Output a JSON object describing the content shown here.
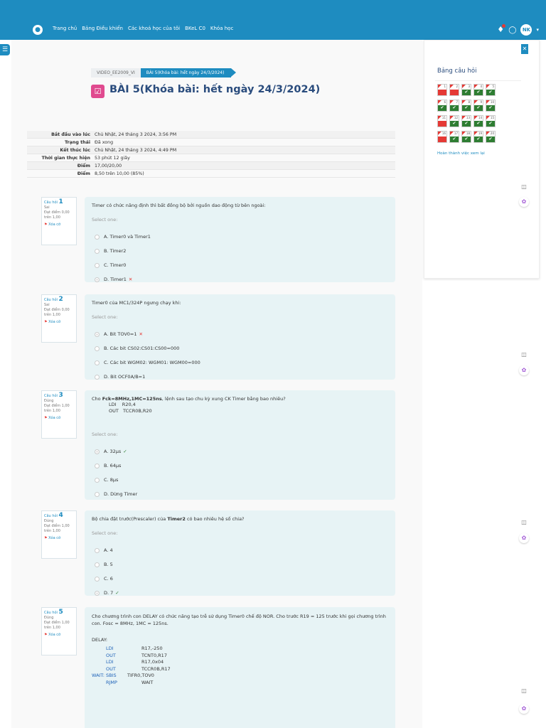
{
  "nav": {
    "items": [
      "Trang chủ",
      "Bảng Điều khiển",
      "Các khoá học của tôi",
      "BKeL C0",
      "Khóa học"
    ],
    "avatar": "NK",
    "caret": "▾"
  },
  "breadcrumbs": [
    "VIDEO_EE2009_VI",
    "BÀI 5(Khóa bài: hết ngày 24/3/2024)"
  ],
  "title": "BÀI 5(Khóa bài: hết ngày 24/3/2024)",
  "summary": [
    {
      "k": "Bắt đầu vào lúc",
      "v": "Chủ Nhật, 24 tháng 3 2024, 3:56 PM"
    },
    {
      "k": "Trạng thái",
      "v": "Đã xong"
    },
    {
      "k": "Kết thúc lúc",
      "v": "Chủ Nhật, 24 tháng 3 2024, 4:49 PM"
    },
    {
      "k": "Thời gian thực hiện",
      "v": "53 phút 12 giây"
    },
    {
      "k": "Điểm",
      "v": "17,00/20,00"
    },
    {
      "k": "Điểm",
      "v": "8,50 trên 10,00 (85%)"
    }
  ],
  "questions": [
    {
      "label": "Câu hỏi",
      "num": "1",
      "status": "Sai",
      "score": "Đạt điểm 0,00",
      "outof": "trên 1,00",
      "flag": "Xóa cờ",
      "text": "Timer có chức năng định thì bất đồng bộ bởi nguồn dao động từ bên ngoài:",
      "select": "Select one:",
      "options": [
        {
          "l": "A.",
          "t": "Timer0 và Timer1"
        },
        {
          "l": "B.",
          "t": "Timer2"
        },
        {
          "l": "C.",
          "t": "Timer0"
        },
        {
          "l": "D.",
          "t": "Timer1",
          "mark": "✕"
        }
      ]
    },
    {
      "label": "Câu hỏi",
      "num": "2",
      "status": "Sai",
      "score": "Đạt điểm 0,00",
      "outof": "trên 1,00",
      "flag": "Xóa cờ",
      "text": "Timer0 của MC1/324P ngưng chạy khi:",
      "select": "Select one:",
      "options": [
        {
          "l": "A.",
          "t": "Bit TOV0=1",
          "mark": "✕"
        },
        {
          "l": "B.",
          "t": "Các bit CS02:CS01:CS00=000"
        },
        {
          "l": "C.",
          "t": "Các bit WGM02: WGM01: WGM00=000"
        },
        {
          "l": "D.",
          "t": "Bit OCF0A/B=1"
        }
      ]
    },
    {
      "label": "Câu hỏi",
      "num": "3",
      "status": "Đúng",
      "score": "Đạt điểm 1,00",
      "outof": "trên 1,00",
      "flag": "Xóa cờ",
      "text_pre": "Cho ",
      "text_bold": "Fck=8MHz,1MC=125ns",
      "text_post": ", lệnh sau tạo chu kỳ xung CK Timer bằng bao nhiêu?",
      "code": [
        "LDI    R20,4",
        "OUT   TCCR0B,R20"
      ],
      "select": "Select one:",
      "options": [
        {
          "l": "A.",
          "t": "32μs",
          "mark": "✓"
        },
        {
          "l": "B.",
          "t": "64μs"
        },
        {
          "l": "C.",
          "t": "8μs"
        },
        {
          "l": "D.",
          "t": "Dừng Timer"
        }
      ]
    },
    {
      "label": "Câu hỏi",
      "num": "4",
      "status": "Đúng",
      "score": "Đạt điểm 1,00",
      "outof": "trên 1,00",
      "flag": "Xóa cờ",
      "text_pre": "Bộ chia đặt trước(Prescaler) của ",
      "text_bold": "Timer2",
      "text_post": " có bao nhiêu hệ số chia?",
      "select": "Select one:",
      "options": [
        {
          "l": "A.",
          "t": "4"
        },
        {
          "l": "B.",
          "t": "5"
        },
        {
          "l": "C.",
          "t": "6"
        },
        {
          "l": "D.",
          "t": "7",
          "mark": "✓"
        }
      ]
    },
    {
      "label": "Câu hỏi",
      "num": "5",
      "status": "Đúng",
      "score": "Đạt điểm 1,00",
      "outof": "trên 1,00",
      "flag": "Xóa cờ",
      "text": "Cho chương trình con DELAY có chức năng tạo trễ sử dụng Timer0 chế độ NOR. Cho trước R19 = 125 trước khi gọi chương trình con. Fosc = 8MHz, 1MC = 125ns.",
      "code_label": "DELAY:",
      "code": [
        [
          "",
          "LDI",
          "R17,-250"
        ],
        [
          "",
          "OUT",
          "TCNT0,R17"
        ],
        [
          "",
          "LDI",
          "R17,0x04"
        ],
        [
          "",
          "OUT",
          "TCCR0B,R17"
        ],
        [
          "WAIT:",
          "SBIS",
          "TIFR0,TOV0"
        ],
        [
          "",
          "RJMP",
          "WAIT"
        ]
      ]
    }
  ],
  "sidebar": {
    "close": "✕",
    "title": "Bảng câu hỏi",
    "finish": "Hoàn thành việc xem lại",
    "cells": [
      {
        "n": "1",
        "s": "wrong"
      },
      {
        "n": "2",
        "s": "wrong"
      },
      {
        "n": "3",
        "s": "ok"
      },
      {
        "n": "4",
        "s": "ok"
      },
      {
        "n": "5",
        "s": "ok"
      },
      {
        "n": "6",
        "s": "ok"
      },
      {
        "n": "7",
        "s": "ok"
      },
      {
        "n": "8",
        "s": "ok"
      },
      {
        "n": "9",
        "s": "ok"
      },
      {
        "n": "10",
        "s": "ok"
      },
      {
        "n": "11",
        "s": "wrong"
      },
      {
        "n": "12",
        "s": "ok"
      },
      {
        "n": "13",
        "s": "ok"
      },
      {
        "n": "14",
        "s": "ok"
      },
      {
        "n": "15",
        "s": "ok"
      },
      {
        "n": "16",
        "s": "wrong"
      },
      {
        "n": "17",
        "s": "ok"
      },
      {
        "n": "18",
        "s": "ok"
      },
      {
        "n": "19",
        "s": "ok"
      },
      {
        "n": "20",
        "s": "ok"
      }
    ]
  },
  "colors": {
    "brand": "#1e8cc0",
    "correct": "#2e7d32",
    "incorrect": "#e53935",
    "card": "#e7f3f5"
  }
}
